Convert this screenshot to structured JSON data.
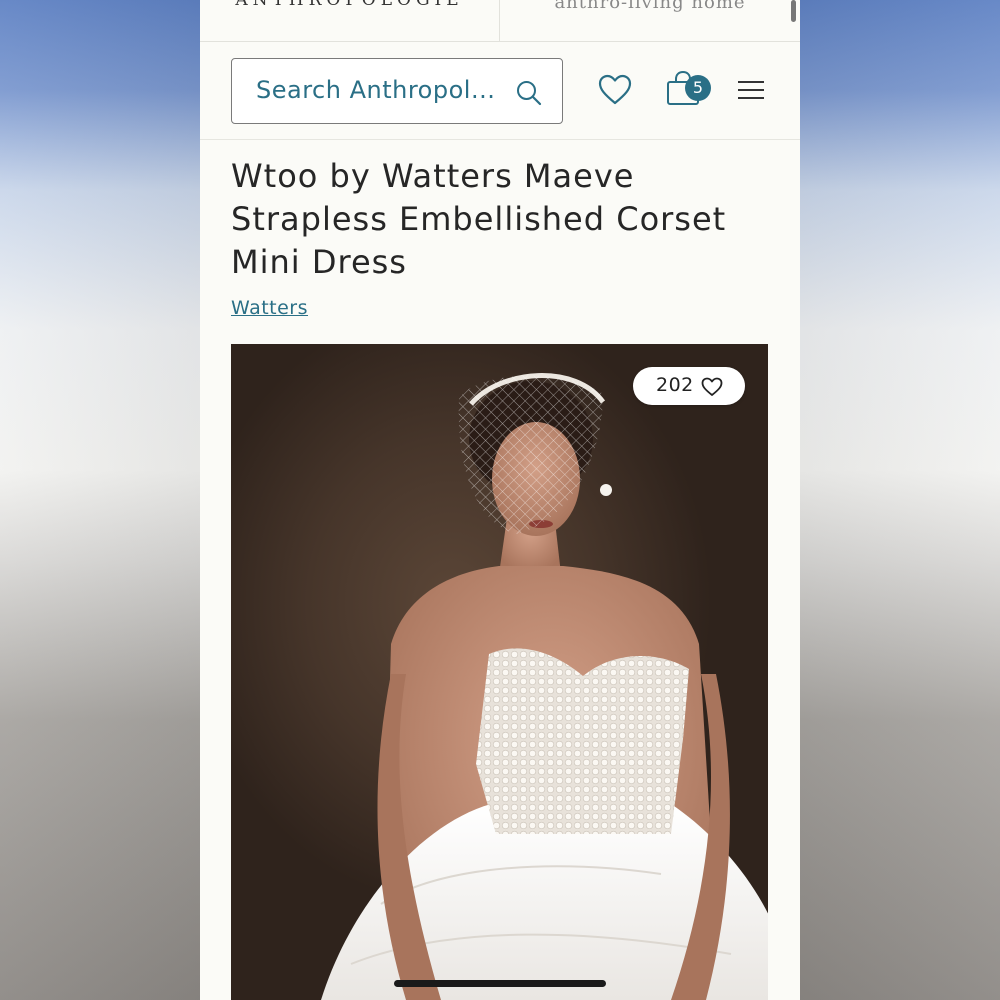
{
  "brands": {
    "left": "ANTHROPOLOGIE",
    "right": "anthro-living home"
  },
  "search": {
    "placeholder": "Search Anthropol..."
  },
  "icons": {
    "search": "search-icon",
    "wishlist": "heart-icon",
    "bag": "shopping-bag-icon",
    "menu": "hamburger-menu-icon"
  },
  "bag": {
    "count": "5"
  },
  "product": {
    "title": "Wtoo by Watters Maeve Strapless Embellished Corset Mini Dress",
    "brand": "Watters",
    "likes": "202"
  },
  "colors": {
    "accent": "#2a6f86",
    "page_background": "#fbfbf7"
  }
}
